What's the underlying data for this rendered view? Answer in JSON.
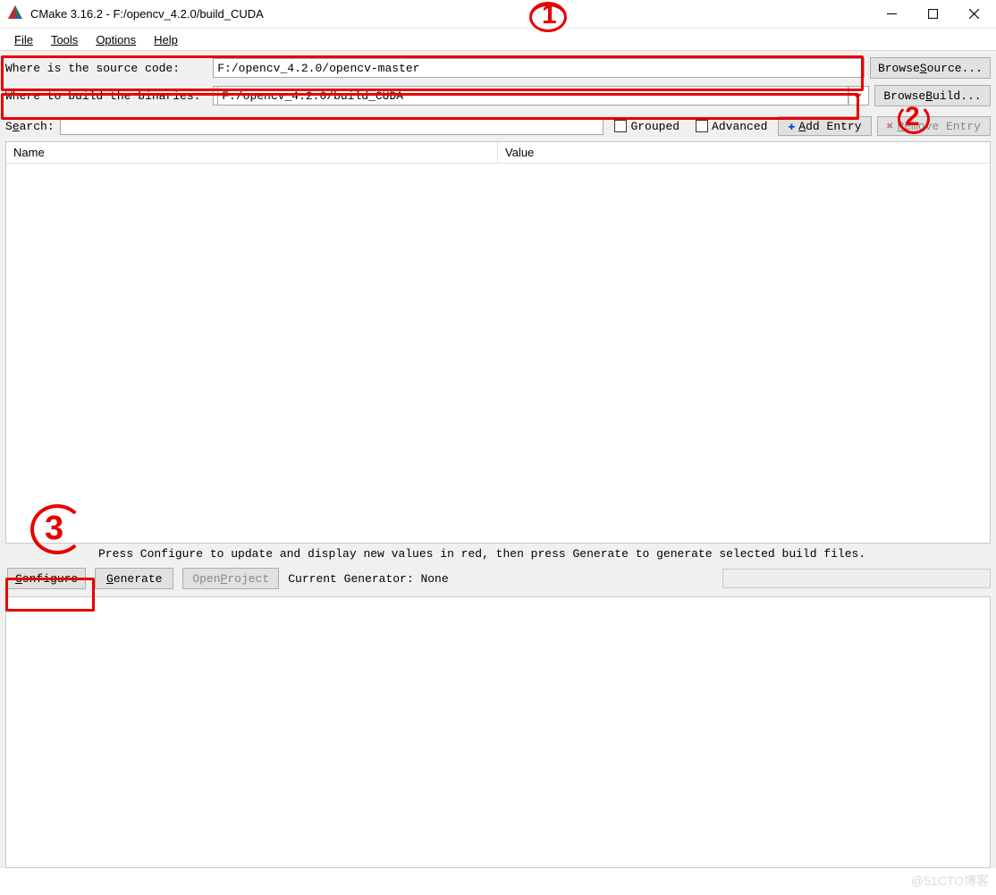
{
  "window": {
    "title": "CMake 3.16.2 - F:/opencv_4.2.0/build_CUDA"
  },
  "menubar": {
    "file": "File",
    "tools": "Tools",
    "options": "Options",
    "help": "Help"
  },
  "paths": {
    "source_label": "Where is the source code:    ",
    "source_value": "F:/opencv_4.2.0/opencv-master",
    "browse_source_pre": "Browse ",
    "browse_source_ul": "S",
    "browse_source_post": "ource...",
    "build_label": "Where to build the binaries: ",
    "build_value": "F:/opencv_4.2.0/build_CUDA",
    "browse_build_pre": "Browse ",
    "browse_build_ul": "B",
    "browse_build_post": "uild..."
  },
  "search": {
    "label_ul": "e",
    "label_pre": "S",
    "label_post": "arch:",
    "value": "",
    "grouped": "Grouped",
    "advanced": "Advanced",
    "add_entry_ul": "A",
    "add_entry_post": "dd Entry",
    "remove_entry_ul": "R",
    "remove_entry_post": "emove Entry"
  },
  "table": {
    "col_name": "Name",
    "col_value": "Value"
  },
  "hint": "Press Configure to update and display new values in red, then press Generate to generate selected build files.",
  "actions": {
    "configure_ul": "C",
    "configure_post": "onfigure",
    "generate_ul": "G",
    "generate_post": "enerate",
    "open_project_pre": "Open ",
    "open_project_ul": "P",
    "open_project_post": "roject",
    "current_generator": "Current Generator: None"
  },
  "annotations": {
    "one": "1",
    "two": "2",
    "three": "3"
  },
  "watermark": "@51CTO博客"
}
